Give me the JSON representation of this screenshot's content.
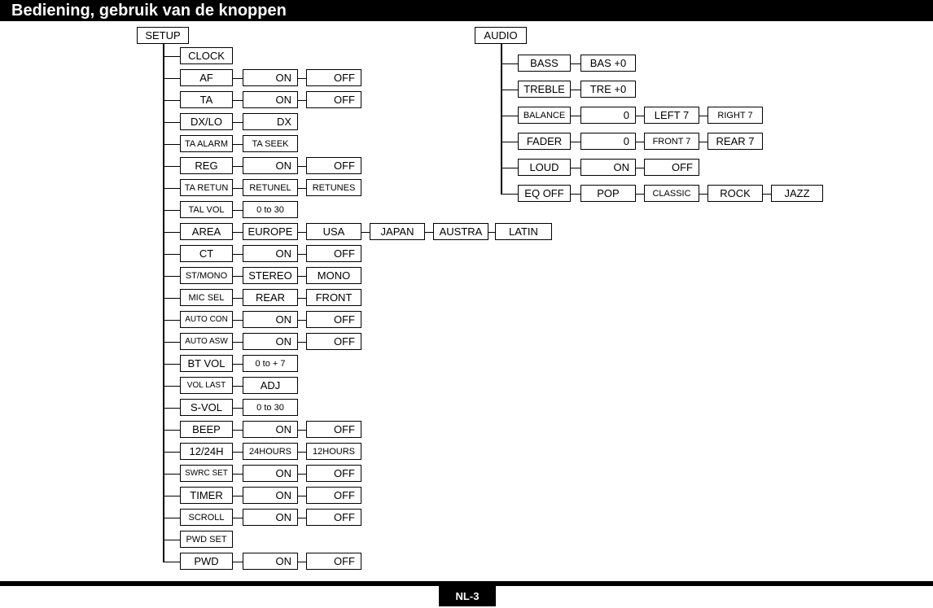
{
  "header": {
    "title": "Bediening, gebruik van de knoppen"
  },
  "footer": {
    "page_label": "NL-3"
  },
  "diagram": {
    "type": "menu-tree",
    "trees": [
      {
        "id": "setup",
        "root": "SETUP",
        "rows": [
          {
            "label": "CLOCK",
            "options": []
          },
          {
            "label": "AF",
            "options": [
              "ON",
              "OFF"
            ]
          },
          {
            "label": "TA",
            "options": [
              "ON",
              "OFF"
            ]
          },
          {
            "label": "DX/LO",
            "options": [
              "DX"
            ]
          },
          {
            "label": "TA ALARM",
            "options": [
              "TA SEEK"
            ]
          },
          {
            "label": "REG",
            "options": [
              "ON",
              "OFF"
            ]
          },
          {
            "label": "TA RETUN",
            "options": [
              "RETUNEL",
              "RETUNES"
            ]
          },
          {
            "label": "TAL VOL",
            "options": [
              "0 to 30"
            ]
          },
          {
            "label": "AREA",
            "options": [
              "EUROPE",
              "USA",
              "JAPAN",
              "AUSTRA",
              "LATIN"
            ]
          },
          {
            "label": "CT",
            "options": [
              "ON",
              "OFF"
            ]
          },
          {
            "label": "ST/MONO",
            "options": [
              "STEREO",
              "MONO"
            ]
          },
          {
            "label": "MIC SEL",
            "options": [
              "REAR",
              "FRONT"
            ]
          },
          {
            "label": "AUTO CON",
            "options": [
              "ON",
              "OFF"
            ]
          },
          {
            "label": "AUTO ASW",
            "options": [
              "ON",
              "OFF"
            ]
          },
          {
            "label": "BT VOL",
            "options": [
              "0 to + 7"
            ]
          },
          {
            "label": "VOL LAST",
            "options": [
              "ADJ"
            ]
          },
          {
            "label": "S-VOL",
            "options": [
              "0 to 30"
            ]
          },
          {
            "label": "BEEP",
            "options": [
              "ON",
              "OFF"
            ]
          },
          {
            "label": "12/24H",
            "options": [
              "24HOURS",
              "12HOURS"
            ]
          },
          {
            "label": "SWRC SET",
            "options": [
              "ON",
              "OFF"
            ]
          },
          {
            "label": "TIMER",
            "options": [
              "ON",
              "OFF"
            ]
          },
          {
            "label": "SCROLL",
            "options": [
              "ON",
              "OFF"
            ]
          },
          {
            "label": "PWD SET",
            "options": []
          },
          {
            "label": "PWD",
            "options": [
              "ON",
              "OFF"
            ]
          }
        ]
      },
      {
        "id": "audio",
        "root": "AUDIO",
        "rows": [
          {
            "label": "BASS",
            "options": [
              "BAS +0"
            ]
          },
          {
            "label": "TREBLE",
            "options": [
              "TRE +0"
            ]
          },
          {
            "label": "BALANCE",
            "options": [
              "0",
              "LEFT 7",
              "RIGHT 7"
            ]
          },
          {
            "label": "FADER",
            "options": [
              "0",
              "FRONT 7",
              "REAR 7"
            ]
          },
          {
            "label": "LOUD",
            "options": [
              "ON",
              "OFF"
            ]
          },
          {
            "label": "EQ OFF",
            "options": [
              "POP",
              "CLASSIC",
              "ROCK",
              "JAZZ"
            ]
          }
        ]
      }
    ]
  },
  "colors": {
    "ink": "#000000",
    "paper": "#ffffff"
  }
}
